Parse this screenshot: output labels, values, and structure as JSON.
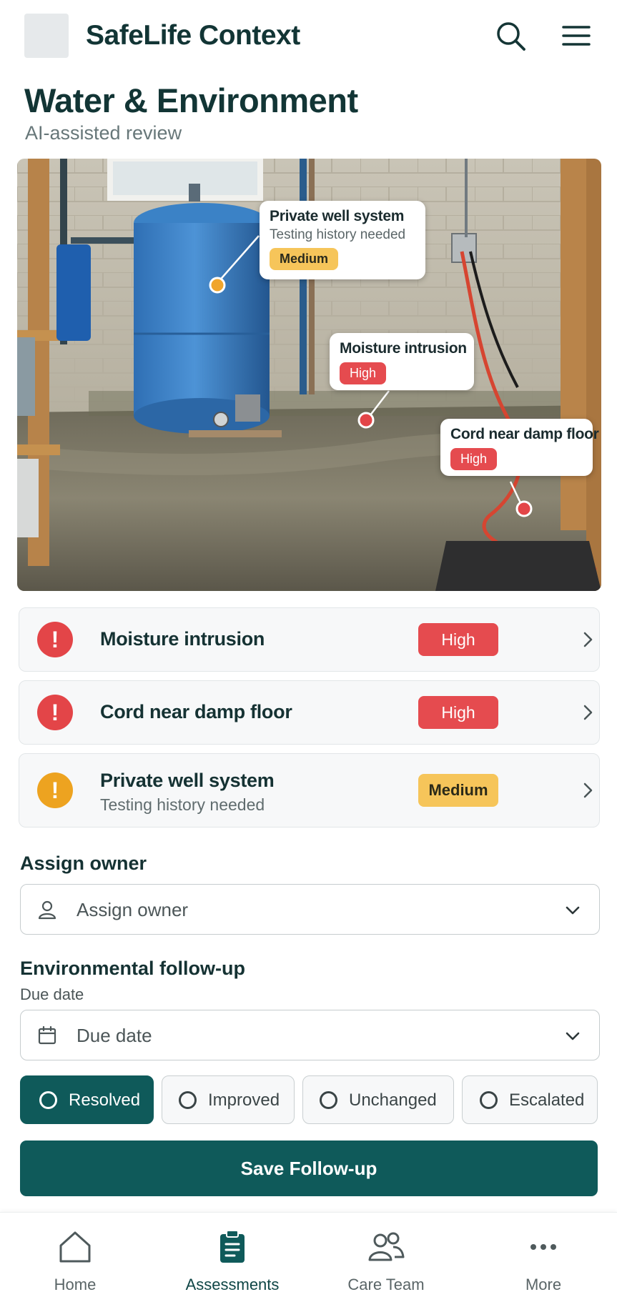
{
  "header": {
    "app_title": "SafeLife Context",
    "icons": [
      "search-icon",
      "menu-icon"
    ]
  },
  "page": {
    "title": "Water & Environment",
    "subtitle": "AI-assisted review"
  },
  "photo": {
    "callouts": [
      {
        "title": "Private well system",
        "subtitle": "Testing history needed",
        "severity": "Medium"
      },
      {
        "title": "Moisture intrusion",
        "severity": "High"
      },
      {
        "title": "Cord near damp floor",
        "severity": "High"
      }
    ]
  },
  "findings": [
    {
      "title": "Moisture intrusion",
      "severity": "High",
      "icon": "alert-icon",
      "color": "#e34548"
    },
    {
      "title": "Cord near damp floor",
      "severity": "High",
      "icon": "alert-icon",
      "color": "#e34548"
    },
    {
      "title": "Private well system",
      "subtitle": "Testing history needed",
      "severity": "Medium",
      "icon": "alert-icon",
      "color": "#eda320"
    }
  ],
  "form": {
    "owner_label": "Assign owner",
    "owner_placeholder": "Assign owner",
    "followup_label": "Environmental follow-up",
    "due_date_label": "Due date",
    "due_date_placeholder": "Due date",
    "statuses": [
      "Resolved",
      "Improved",
      "Unchanged",
      "Escalated"
    ],
    "selected_status": "Resolved",
    "save_label": "Save Follow-up"
  },
  "bottom_nav": [
    {
      "label": "Home",
      "icon": "home-icon"
    },
    {
      "label": "Assessments",
      "icon": "clipboard-icon",
      "active": true
    },
    {
      "label": "Care Team",
      "icon": "people-icon"
    },
    {
      "label": "More",
      "icon": "more-icon"
    }
  ],
  "colors": {
    "primary": "#0f5a5a",
    "high": "#e54b4f",
    "medium": "#f6c55a"
  }
}
